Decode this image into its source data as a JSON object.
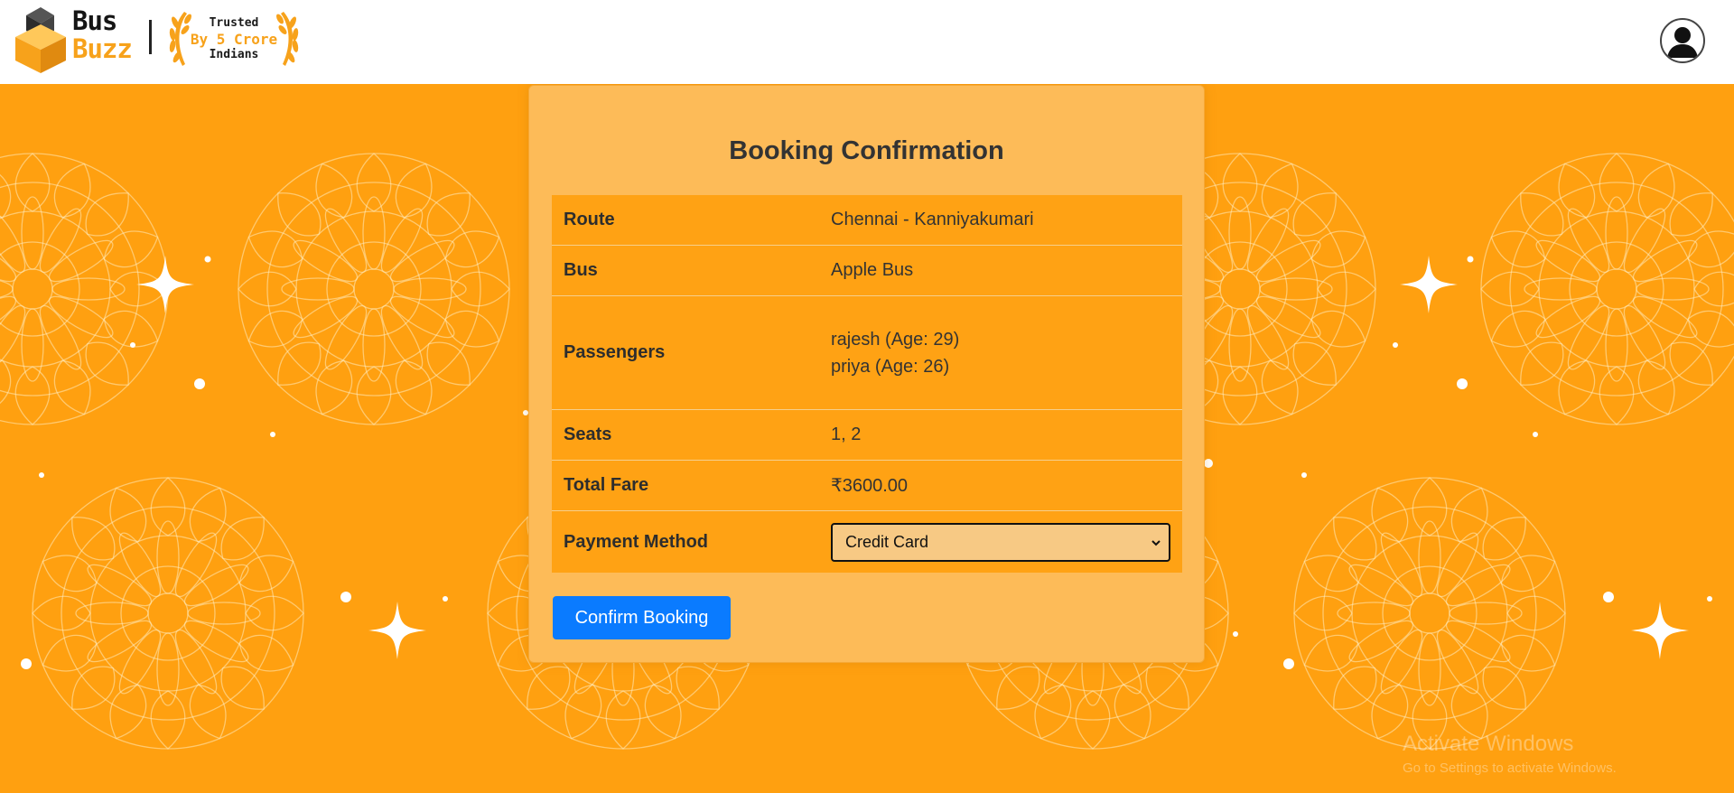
{
  "header": {
    "logo_line1": "Bus",
    "logo_line2": "Buzz",
    "badge_line1": "Trusted",
    "badge_line2": "By 5 Crore",
    "badge_line3": "Indians",
    "avatar_icon": "user-avatar-icon"
  },
  "booking": {
    "title": "Booking Confirmation",
    "rows": [
      {
        "label": "Route",
        "value": "Chennai - Kanniyakumari"
      },
      {
        "label": "Bus",
        "value": "Apple Bus"
      },
      {
        "label": "Passengers",
        "values": [
          "rajesh (Age: 29)",
          "priya (Age: 26)"
        ]
      },
      {
        "label": "Seats",
        "value": "1, 2"
      },
      {
        "label": "Total Fare",
        "value": "₹3600.00"
      },
      {
        "label": "Payment Method",
        "selected": "Credit Card"
      }
    ],
    "confirm_label": "Confirm Booking"
  },
  "watermark": {
    "line1": "Activate Windows",
    "line2": "Go to Settings to activate Windows."
  },
  "colors": {
    "background": "#ffa010",
    "card": "#fdbb58",
    "table": "#ffa214",
    "button": "#0a7bff",
    "brand_orange": "#f7a21b"
  }
}
